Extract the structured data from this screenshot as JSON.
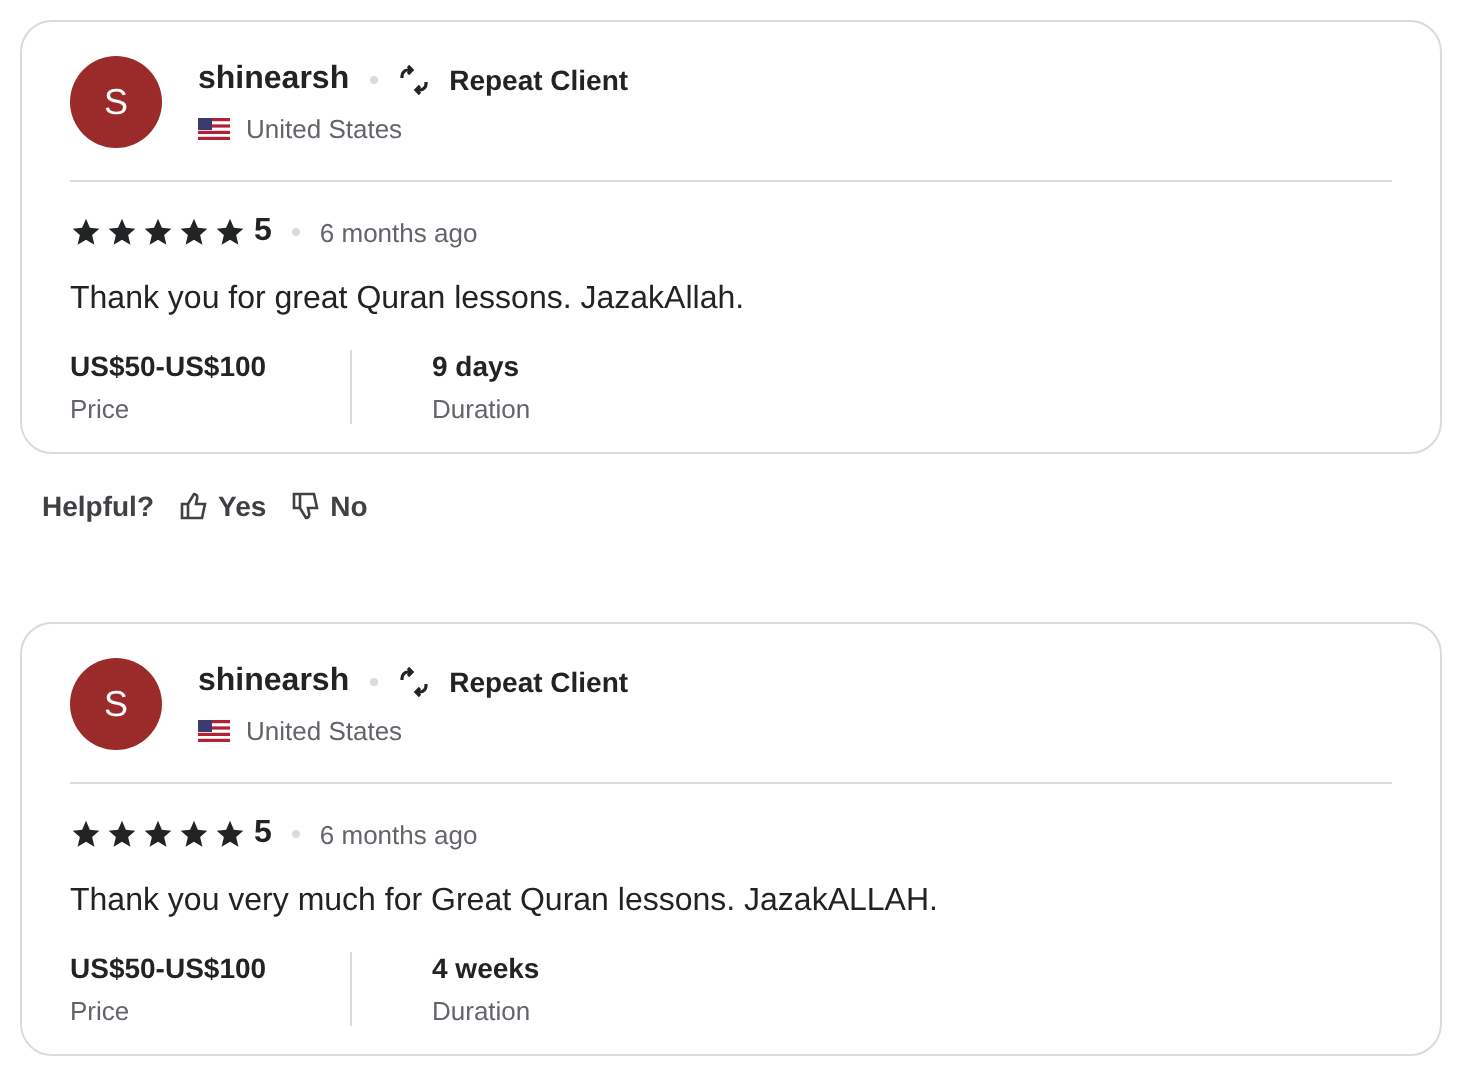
{
  "reviews": [
    {
      "avatar_letter": "S",
      "name": "shinearsh",
      "badge": "Repeat Client",
      "country": "United States",
      "stars": 5,
      "rating": "5",
      "time": "6 months ago",
      "text": "Thank you for great Quran lessons. JazakAllah.",
      "price": "US$50-US$100",
      "price_label": "Price",
      "duration": "9 days",
      "duration_label": "Duration",
      "helpful": {
        "label": "Helpful?",
        "yes": "Yes",
        "no": "No"
      }
    },
    {
      "avatar_letter": "S",
      "name": "shinearsh",
      "badge": "Repeat Client",
      "country": "United States",
      "stars": 5,
      "rating": "5",
      "time": "6 months ago",
      "text": "Thank you very much for Great Quran lessons. JazakALLAH.",
      "price": "US$50-US$100",
      "price_label": "Price",
      "duration": "4 weeks",
      "duration_label": "Duration"
    }
  ]
}
